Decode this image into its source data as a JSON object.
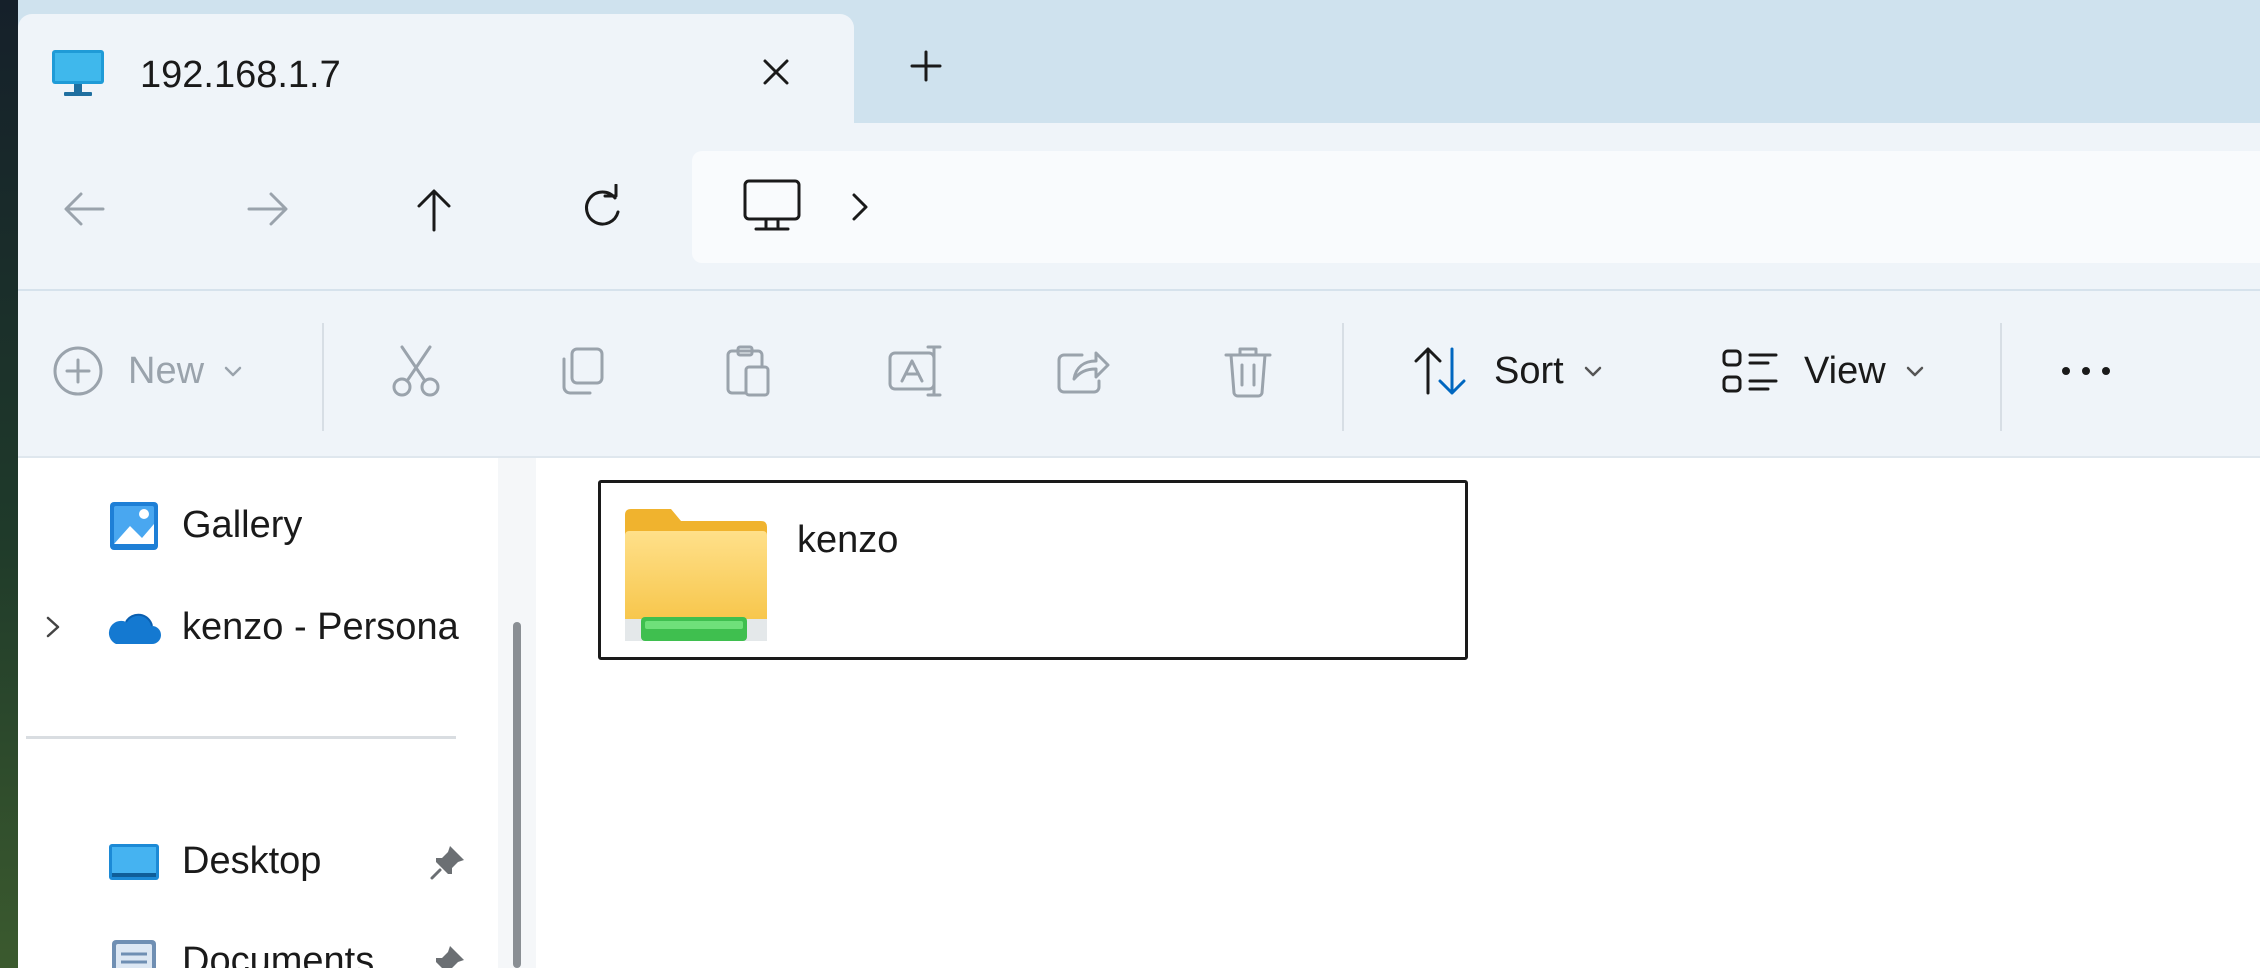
{
  "tab": {
    "title": "192.168.1.7",
    "icon": "monitor-icon",
    "close_icon": "close-icon",
    "new_tab_icon": "plus-icon"
  },
  "nav": {
    "back_icon": "arrow-left-icon",
    "forward_icon": "arrow-right-icon",
    "up_icon": "arrow-up-icon",
    "refresh_icon": "refresh-icon",
    "address_icon": "pc-icon",
    "address_chevron": "chevron-right-icon"
  },
  "toolbar": {
    "new_label": "New",
    "sort_label": "Sort",
    "view_label": "View",
    "more_label": "•••",
    "icons": [
      "add-circle-icon",
      "cut-icon",
      "copy-icon",
      "paste-icon",
      "rename-icon",
      "share-icon",
      "delete-icon",
      "sort-icon",
      "view-icon",
      "more-icon"
    ]
  },
  "sidebar": {
    "items": [
      {
        "label": "Gallery",
        "icon": "gallery-icon"
      },
      {
        "label": "kenzo - Persona",
        "icon": "onedrive-cloud-icon",
        "expandable": true
      },
      {
        "label": "Desktop",
        "icon": "desktop-folder-icon",
        "pinned": true
      },
      {
        "label": "Documents",
        "icon": "documents-icon",
        "pinned": true
      }
    ]
  },
  "content": {
    "items": [
      {
        "name": "kenzo",
        "icon": "network-share-folder-icon"
      }
    ]
  },
  "colors": {
    "tabstrip": "#cfe2ee",
    "chrome": "#eff4f9",
    "accent": "#0067c0",
    "folder_yellow": "#f5c04a",
    "share_green": "#3fbf4f"
  }
}
